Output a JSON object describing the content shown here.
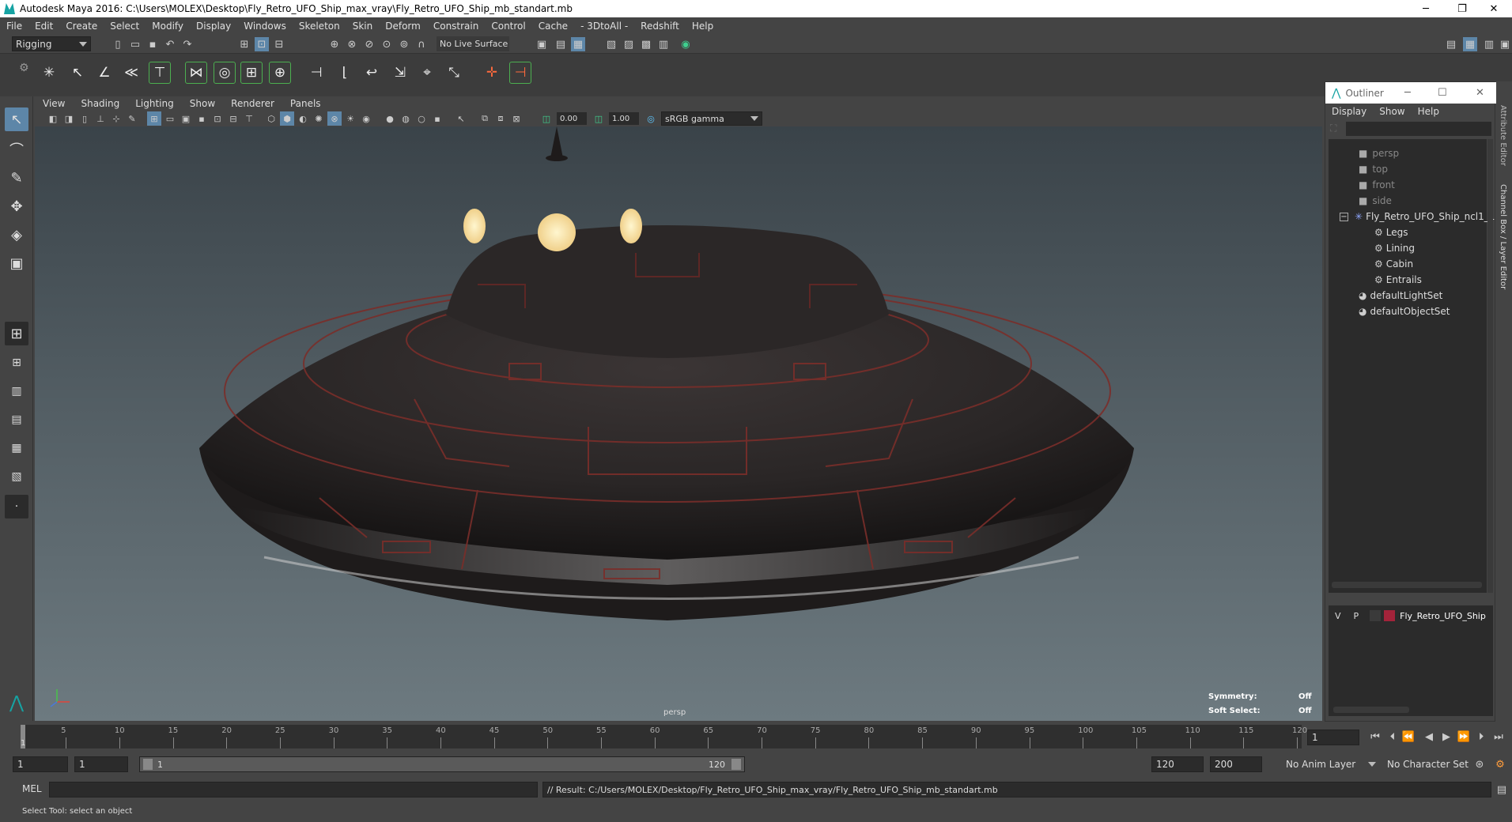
{
  "window": {
    "title": "Autodesk Maya 2016: C:\\Users\\MOLEX\\Desktop\\Fly_Retro_UFO_Ship_max_vray\\Fly_Retro_UFO_Ship_mb_standart.mb",
    "minimize": "─",
    "restore": "❐",
    "close": "✕"
  },
  "menubar": [
    "File",
    "Edit",
    "Create",
    "Select",
    "Modify",
    "Display",
    "Windows",
    "Skeleton",
    "Skin",
    "Deform",
    "Constrain",
    "Control",
    "Cache",
    "- 3DtoAll -",
    "Redshift",
    "Help"
  ],
  "statusline": {
    "menuset": "Rigging",
    "live_surface": "No Live Surface"
  },
  "panel": {
    "menus": [
      "View",
      "Shading",
      "Lighting",
      "Show",
      "Renderer",
      "Panels"
    ],
    "near_clip": "0.00",
    "far_clip": "1.00",
    "color_space": "sRGB gamma"
  },
  "viewport": {
    "camera_label": "persp",
    "symmetry_label": "Symmetry:",
    "symmetry_value": "Off",
    "soft_select_label": "Soft Select:",
    "soft_select_value": "Off",
    "colors": {
      "ufo_body": "#2a2626",
      "panel_line": "#7a2e2a",
      "window_glow": "#f7dca0"
    }
  },
  "outliner": {
    "title": "Outliner",
    "menus": [
      "Display",
      "Show",
      "Help"
    ],
    "items": [
      {
        "label": "persp",
        "icon": "camera-icon"
      },
      {
        "label": "top",
        "icon": "camera-icon"
      },
      {
        "label": "front",
        "icon": "camera-icon"
      },
      {
        "label": "side",
        "icon": "camera-icon"
      },
      {
        "label": "Fly_Retro_UFO_Ship_ncl1_1",
        "icon": "asterisk-icon"
      },
      {
        "label": "Legs",
        "icon": "group-icon"
      },
      {
        "label": "Lining",
        "icon": "group-icon"
      },
      {
        "label": "Cabin",
        "icon": "group-icon"
      },
      {
        "label": "Entrails",
        "icon": "group-icon"
      },
      {
        "label": "defaultLightSet",
        "icon": "set-icon"
      },
      {
        "label": "defaultObjectSet",
        "icon": "set-icon"
      }
    ],
    "layer": {
      "v": "V",
      "p": "P",
      "name": "Fly_Retro_UFO_Ship",
      "color": "#a3233a"
    }
  },
  "side_tabs": [
    "Attribute Editor",
    "Channel Box / Layer Editor"
  ],
  "timeline": {
    "ticks": [
      "5",
      "10",
      "15",
      "20",
      "25",
      "30",
      "35",
      "40",
      "45",
      "50",
      "55",
      "60",
      "65",
      "70",
      "75",
      "80",
      "85",
      "90",
      "95",
      "100",
      "105",
      "110",
      "115",
      "120"
    ],
    "start_tick": "1",
    "current_frame": "1"
  },
  "range": {
    "start": "1",
    "playback_start": "1",
    "range_start_label": "1",
    "range_end_label": "120",
    "playback_end": "120",
    "end": "200",
    "anim_layer": "No Anim Layer",
    "char_set": "No Character Set"
  },
  "cmdline": {
    "lang": "MEL",
    "result": "// Result: C:/Users/MOLEX/Desktop/Fly_Retro_UFO_Ship_max_vray/Fly_Retro_UFO_Ship_mb_standart.mb"
  },
  "helpline": "Select Tool: select an object"
}
